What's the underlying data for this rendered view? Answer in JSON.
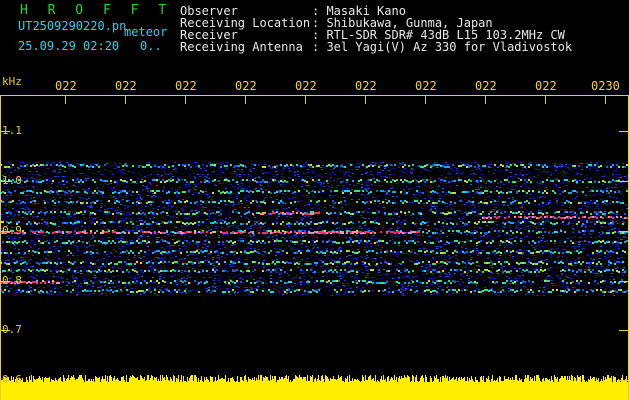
{
  "header": {
    "brand": "H R O F F T",
    "file": "UT2509290220.pn",
    "mode": "meteor",
    "datetime": "25.09.29 02:20",
    "status": "0.."
  },
  "info": {
    "observer_label": "Observer",
    "observer_value": ": Masaki Kano",
    "location_label": "Receiving Location",
    "location_value": ": Shibukawa, Gunma, Japan",
    "receiver_label": "Receiver",
    "receiver_value": ": RTL-SDR SDR# 43dB L15 103.2MHz CW",
    "antenna_label": "Receiving Antenna",
    "antenna_value": ": 3el Yagi(V) Az 330 for Vladivostok"
  },
  "axis": {
    "y_unit": "kHz",
    "y_ticks": [
      "1.1",
      "1.0",
      "0.9",
      "0.8",
      "0.7",
      "0.6"
    ],
    "x_ticks": [
      "022",
      "022",
      "022",
      "022",
      "022",
      "022",
      "022",
      "022",
      "022",
      "0230"
    ]
  },
  "colors": {
    "background": "#000000",
    "axis": "#e6cf2a",
    "brand": "#22d33a",
    "info_label": "#e8e8e8",
    "info_value": "#e8e8e8",
    "noise_floor": "#ffee00"
  }
}
